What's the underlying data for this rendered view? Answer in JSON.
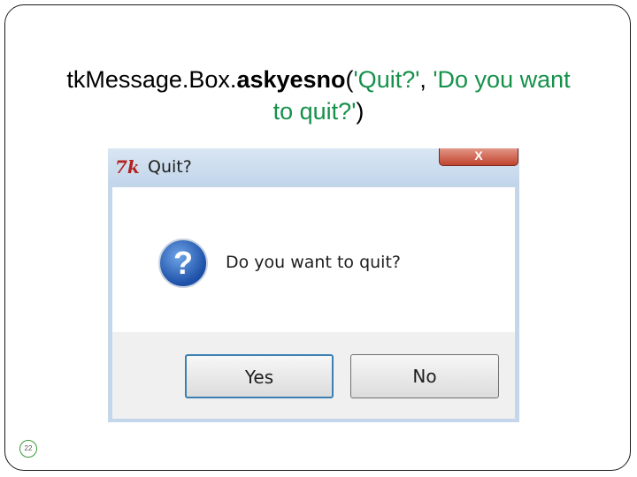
{
  "slide": {
    "title": {
      "prefix": "tkMessage.Box.",
      "function": "askyesno",
      "open": "(",
      "arg1": "'Quit?'",
      "sep": ", ",
      "arg2_line1": "'Do you want",
      "arg2_line2": "to quit?'",
      "close": ")"
    },
    "page_number": "22"
  },
  "dialog": {
    "title": "Quit?",
    "app_icon_glyph": "7k",
    "close_glyph": "X",
    "icon": "question-icon",
    "icon_glyph": "?",
    "message": "Do you want to quit?",
    "buttons": {
      "yes": "Yes",
      "no": "No"
    }
  }
}
